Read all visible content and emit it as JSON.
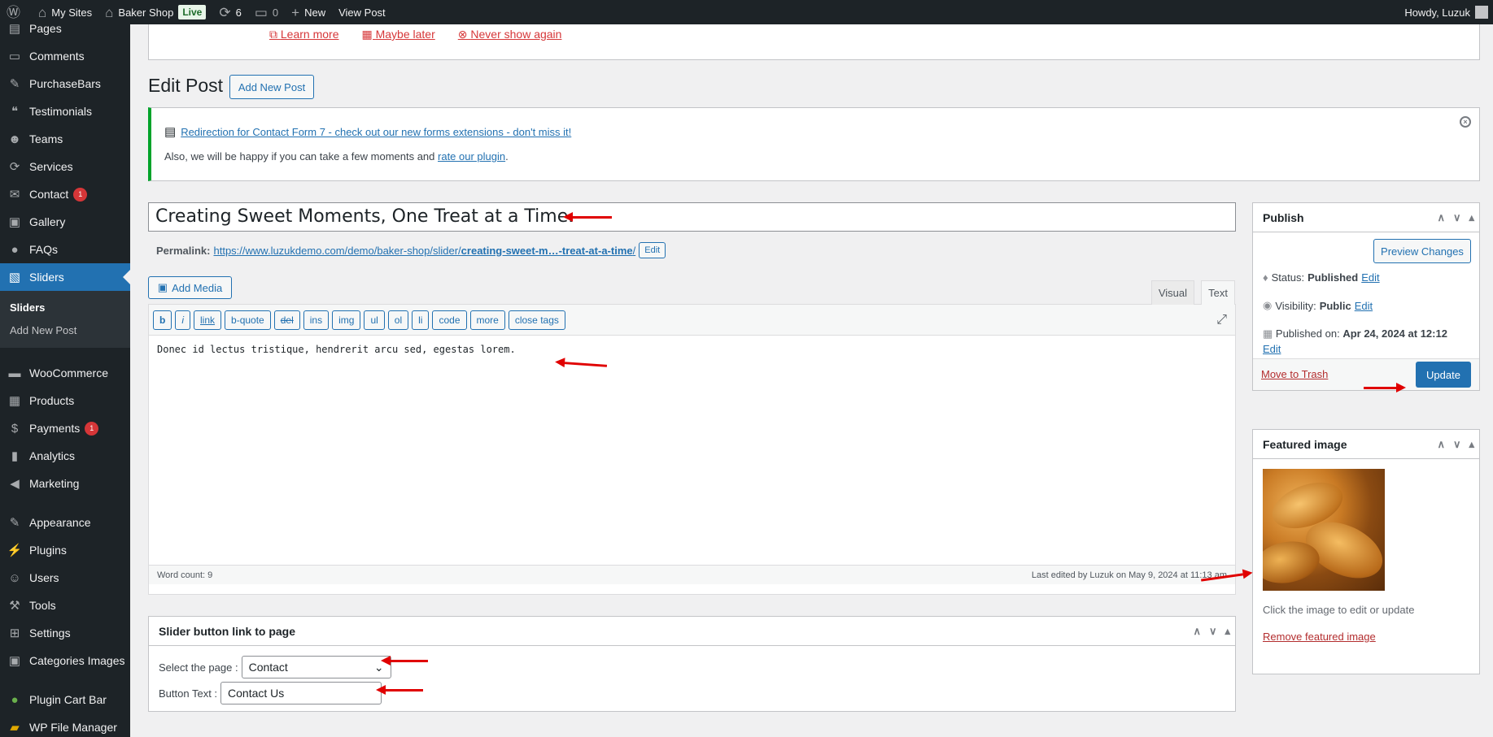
{
  "adminbar": {
    "my_sites": "My Sites",
    "site_name": "Baker Shop",
    "live_badge": "Live",
    "updates_count": "6",
    "comments_count": "0",
    "new_label": "New",
    "view_post": "View Post",
    "greeting": "Howdy, Luzuk"
  },
  "sidebar": {
    "items_top": [
      {
        "label": "Pages",
        "icon": "pages-icon"
      },
      {
        "label": "Comments",
        "icon": "comments-icon"
      },
      {
        "label": "PurchaseBars",
        "icon": "pin-icon"
      },
      {
        "label": "Testimonials",
        "icon": "testimonials-icon"
      },
      {
        "label": "Teams",
        "icon": "teams-icon"
      },
      {
        "label": "Services",
        "icon": "services-icon"
      },
      {
        "label": "Contact",
        "icon": "mail-icon",
        "badge": "1"
      },
      {
        "label": "Gallery",
        "icon": "gallery-icon"
      },
      {
        "label": "FAQs",
        "icon": "faq-icon"
      },
      {
        "label": "Sliders",
        "icon": "sliders-icon"
      }
    ],
    "submenu": [
      "Sliders",
      "Add New Post"
    ],
    "items_bottom": [
      {
        "label": "WooCommerce",
        "icon": "woocommerce-icon"
      },
      {
        "label": "Products",
        "icon": "products-icon"
      },
      {
        "label": "Payments",
        "icon": "payments-icon",
        "badge": "1"
      },
      {
        "label": "Analytics",
        "icon": "analytics-icon"
      },
      {
        "label": "Marketing",
        "icon": "marketing-icon"
      }
    ],
    "items_tools": [
      {
        "label": "Appearance",
        "icon": "appearance-icon"
      },
      {
        "label": "Plugins",
        "icon": "plugins-icon"
      },
      {
        "label": "Users",
        "icon": "users-icon"
      },
      {
        "label": "Tools",
        "icon": "tools-icon"
      },
      {
        "label": "Settings",
        "icon": "settings-icon"
      },
      {
        "label": "Categories Images",
        "icon": "categories-images-icon"
      }
    ],
    "items_extra": [
      {
        "label": "Plugin Cart Bar",
        "icon": "cart-bar-icon"
      },
      {
        "label": "WP File Manager",
        "icon": "file-manager-icon"
      }
    ]
  },
  "top_notice": {
    "learn_more": "Learn more",
    "maybe_later": "Maybe later",
    "never_show": "Never show again"
  },
  "page": {
    "title": "Edit Post",
    "add_new": "Add New Post"
  },
  "notice": {
    "link_text": "Redirection for Contact Form 7 - check out our new forms extensions - don't miss it!",
    "text_before": "Also, we will be happy if you can take a few moments and ",
    "rate_link": "rate our plugin",
    "text_after": "."
  },
  "post": {
    "title": "Creating Sweet Moments, One Treat at a Time.",
    "permalink_label": "Permalink:",
    "permalink_base": "https://www.luzukdemo.com/demo/baker-shop/slider/",
    "permalink_slug": "creating-sweet-m…-treat-at-a-time",
    "permalink_end": "/",
    "permalink_edit": "Edit"
  },
  "editor": {
    "add_media": "Add Media",
    "tab_visual": "Visual",
    "tab_text": "Text",
    "quicktags": [
      "b",
      "i",
      "link",
      "b-quote",
      "del",
      "ins",
      "img",
      "ul",
      "ol",
      "li",
      "code",
      "more",
      "close tags"
    ],
    "content": "Donec id lectus tristique, hendrerit arcu sed, egestas lorem.",
    "word_count": "Word count: 9",
    "last_edited": "Last edited by Luzuk on May 9, 2024 at 11:13 am"
  },
  "slider_box": {
    "title": "Slider button link to page",
    "select_label": "Select the page :",
    "select_value": "Contact",
    "button_text_label": "Button Text :",
    "button_text_value": "Contact Us"
  },
  "publish": {
    "title": "Publish",
    "preview": "Preview Changes",
    "status_label": "Status:",
    "status_value": "Published",
    "visibility_label": "Visibility:",
    "visibility_value": "Public",
    "published_label": "Published on:",
    "published_value": "Apr 24, 2024 at 12:12",
    "edit": "Edit",
    "trash": "Move to Trash",
    "update": "Update"
  },
  "featured": {
    "title": "Featured image",
    "hint": "Click the image to edit or update",
    "remove": "Remove featured image"
  },
  "colors": {
    "admin_dark": "#1d2327",
    "accent": "#2271b1",
    "danger": "#d63638",
    "success": "#00a32a",
    "annotation_arrow": "#e00000"
  }
}
